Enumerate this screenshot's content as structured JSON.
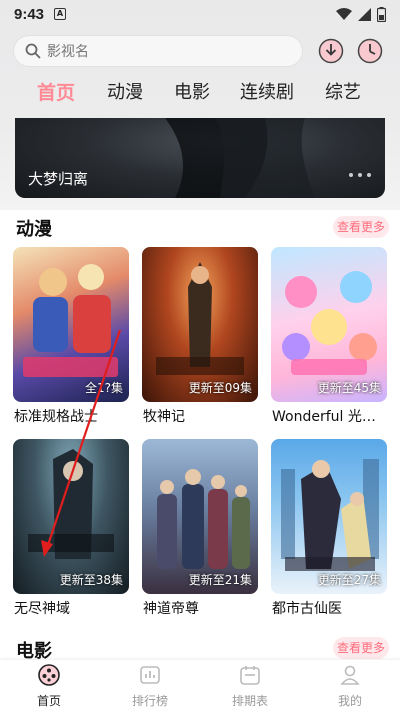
{
  "status_bar": {
    "time": "9:43",
    "notification_letter": "A"
  },
  "search": {
    "placeholder": "影视名"
  },
  "tabs": [
    {
      "label": "首页",
      "active": true
    },
    {
      "label": "动漫",
      "active": false
    },
    {
      "label": "电影",
      "active": false
    },
    {
      "label": "连续剧",
      "active": false
    },
    {
      "label": "综艺",
      "active": false
    }
  ],
  "banner": {
    "title": "大梦归离"
  },
  "sections": [
    {
      "title": "动漫",
      "more_label": "查看更多",
      "items": [
        {
          "title": "标准规格战士",
          "badge": "全1?集"
        },
        {
          "title": "牧神记",
          "badge": "更新至09集"
        },
        {
          "title": "Wonderful 光之美少女",
          "badge": "更新至45集"
        },
        {
          "title": "无尽神域",
          "badge": "更新至38集"
        },
        {
          "title": "神道帝尊",
          "badge": "更新至21集"
        },
        {
          "title": "都市古仙医",
          "badge": "更新至27集"
        }
      ]
    },
    {
      "title": "电影",
      "more_label": "查看更多"
    }
  ],
  "bottom_nav": [
    {
      "label": "首页",
      "active": true
    },
    {
      "label": "排行榜",
      "active": false
    },
    {
      "label": "排期表",
      "active": false
    },
    {
      "label": "我的",
      "active": false
    }
  ],
  "colors": {
    "accent": "#ff8a95",
    "more_text": "#ff6d7e",
    "more_bg": "#fde9ec"
  }
}
